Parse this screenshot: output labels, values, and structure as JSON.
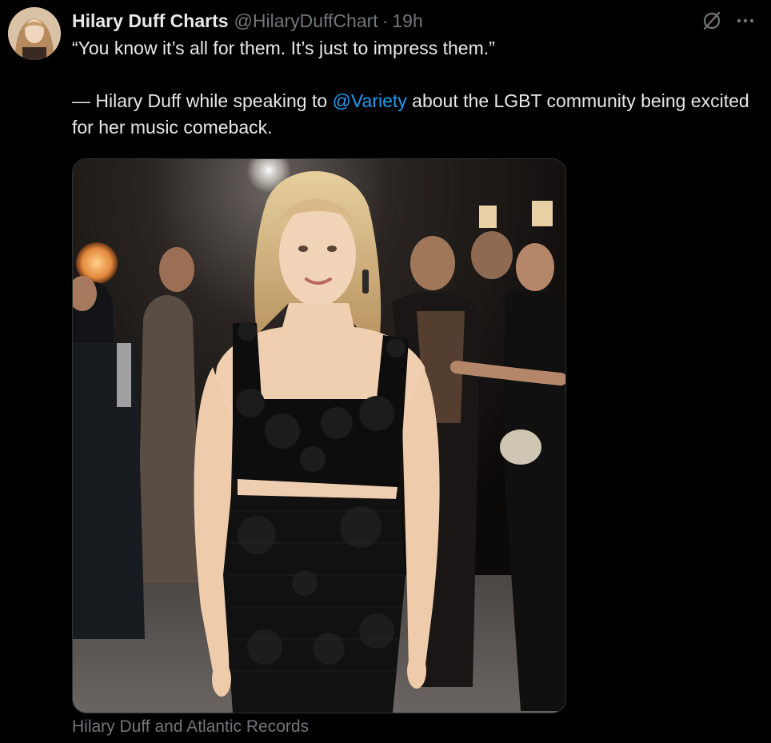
{
  "tweet": {
    "display_name": "Hilary Duff Charts",
    "handle": "@HilaryDuffChart",
    "separator": "·",
    "time": "19h",
    "avatar_icon": "profile-avatar",
    "grok_icon": "grok-icon",
    "more_icon": "more-options-icon",
    "text_line1": "“You know it’s all for them. It’s just to impress them.”",
    "text_line2_prefix": "— Hilary Duff while speaking to ",
    "mention": "@Variety",
    "text_line2_suffix": " about the LGBT community being excited for her music comeback.",
    "media_caption": "Hilary Duff and Atlantic Records"
  },
  "colors": {
    "background": "#000000",
    "primary_text": "#e7e9ea",
    "secondary_text": "#71767b",
    "link": "#1d9bf0",
    "border": "#2f3336"
  }
}
